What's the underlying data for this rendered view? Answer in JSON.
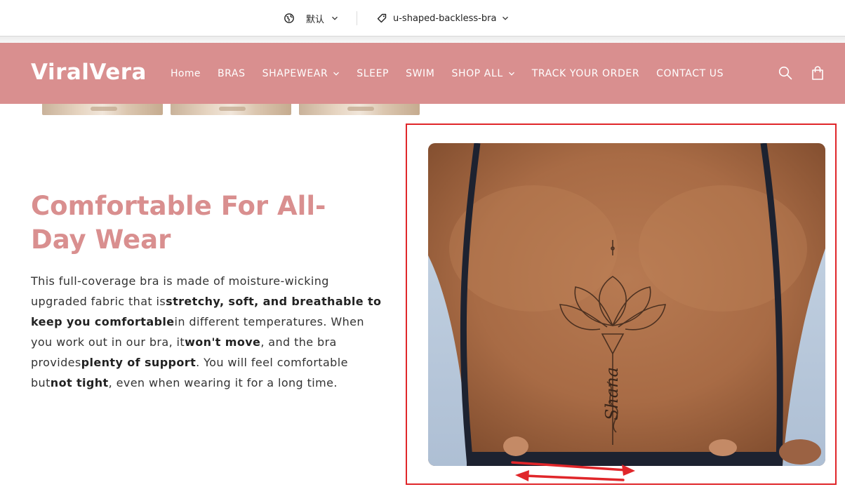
{
  "topbar": {
    "language": {
      "label": "默认",
      "icon": "globe-icon"
    },
    "product": {
      "label": "u-shaped-backless-bra",
      "icon": "tag-icon"
    }
  },
  "header": {
    "logo": "ViralVera",
    "nav": [
      {
        "label": "Home",
        "has_dropdown": false
      },
      {
        "label": "BRAS",
        "has_dropdown": false
      },
      {
        "label": "SHAPEWEAR",
        "has_dropdown": true
      },
      {
        "label": "SLEEP",
        "has_dropdown": false
      },
      {
        "label": "SWIM",
        "has_dropdown": false
      },
      {
        "label": "SHOP ALL",
        "has_dropdown": true
      },
      {
        "label": "TRACK YOUR ORDER",
        "has_dropdown": false
      },
      {
        "label": "CONTACT US",
        "has_dropdown": false
      }
    ],
    "icons": [
      "search-icon",
      "cart-icon"
    ]
  },
  "feature": {
    "heading_line1": "Comfortable For All-",
    "heading_line2": "Day Wear",
    "p1": "This full-coverage bra is made of moisture-wicking upgraded fabric that is",
    "b1": "stretchy, soft, and breathable to keep you comfortable",
    "p2": "in different temperatures. When you work out in our bra, it",
    "b2": "won't move",
    "p3": ", and the bra provides",
    "b3": "plenty of support",
    "p4": ". You will feel comfortable but",
    "b4": "not tight",
    "p5": ", even when wearing it for a long time."
  },
  "photo": {
    "tattoo_text": "Shana"
  },
  "colors": {
    "brand": "#d98f8f",
    "annotation": "#e0262a"
  }
}
